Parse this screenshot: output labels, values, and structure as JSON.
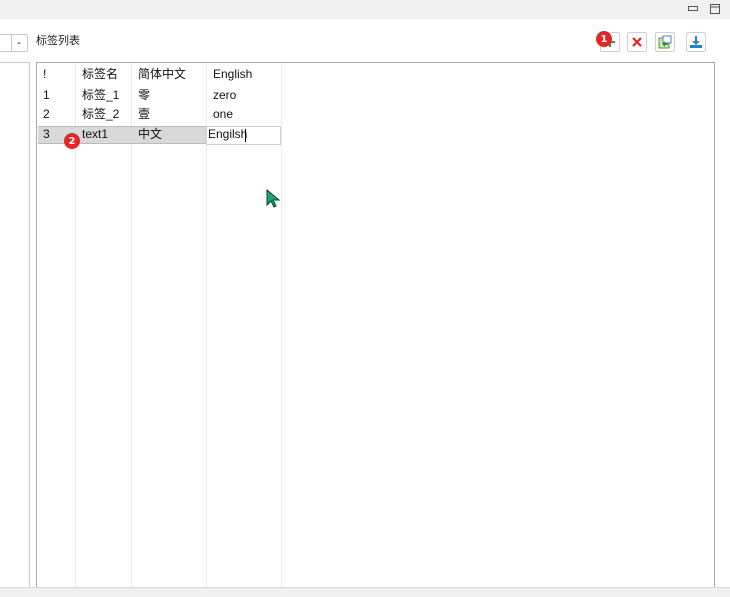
{
  "window": {
    "minimize_glyph": "▭",
    "restore_glyph": "❐"
  },
  "left": {
    "button_minus": "-"
  },
  "panel": {
    "title": "标签列表",
    "toolbar": {
      "add_icon": "add-icon",
      "delete_icon": "delete-icon",
      "import_icon": "import-icon",
      "export_icon": "download-icon"
    }
  },
  "table": {
    "headers": [
      "!",
      "标签名",
      "简体中文",
      "English"
    ],
    "rows": [
      [
        "1",
        "标签_1",
        "零",
        "zero"
      ],
      [
        "2",
        "标签_2",
        "壹",
        "one"
      ],
      [
        "3",
        "text1",
        "中文",
        "Engilsh"
      ]
    ]
  },
  "badges": {
    "one": "1",
    "two": "2"
  },
  "colors": {
    "badge": "#e02727",
    "delete": "#e02424",
    "export": "#1c87d8",
    "cursor": "#1aa37a"
  }
}
